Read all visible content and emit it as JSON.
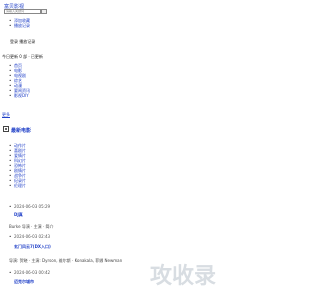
{
  "header": {
    "logo": "富贝影视",
    "search_placeholder": "请输入关键词"
  },
  "top_links": [
    "添加收藏",
    "播放记录"
  ],
  "login": {
    "label": "登录 播放记录"
  },
  "notice": "今日更新 0 部 · 已更新",
  "nav": [
    "首页",
    "电影",
    "电视剧",
    "综艺",
    "动漫",
    "要闻资讯",
    "影视DIY"
  ],
  "more": "更多",
  "section": {
    "title": "最新电影"
  },
  "categories": [
    "动作片",
    "喜剧片",
    "爱情片",
    "科幻片",
    "恐怖片",
    "剧情片",
    "战争片",
    "纪录片",
    "伦理片"
  ],
  "articles": [
    {
      "date": "2024-06-03 05:29",
      "title": "DJ真",
      "desc": "Burke 导演 · 主演 · 简介"
    },
    {
      "date": "2024-06-03 02:43",
      "title": "",
      "desc": ""
    },
    {
      "date": "2024-06-03 01:43",
      "title": "玄门风云7(DX入口)",
      "desc": "导演: 贺晓 · 主演: Dyrson, 维尔斯 · Konakala, 菲娜 Newman"
    },
    {
      "date": "2024-06-03 00:42",
      "title": "迈克尔城市",
      "desc": ""
    }
  ],
  "watermark": {
    "text": "攻收录",
    "color": "#d8dde2"
  }
}
